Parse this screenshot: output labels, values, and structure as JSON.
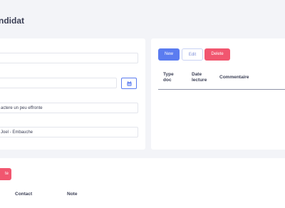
{
  "page": {
    "title": "ndidat"
  },
  "form": {
    "field1_value": "",
    "field2_value": "",
    "field3_value": "actere un peu effronte",
    "field4_value": "Joel - Embauche",
    "calendar_icon": "calendar-icon"
  },
  "documents": {
    "buttons": {
      "new": "New",
      "edit": "Edit",
      "delete": "Delete"
    },
    "columns": [
      "Type doc",
      "Date lecture",
      "Commentaire"
    ],
    "rows": []
  },
  "bottom": {
    "delete_label": "te",
    "columns": [
      "Contact",
      "Note"
    ]
  },
  "colors": {
    "primary": "#5b7cf0",
    "danger": "#f1566f",
    "background": "#f3f4f8"
  }
}
